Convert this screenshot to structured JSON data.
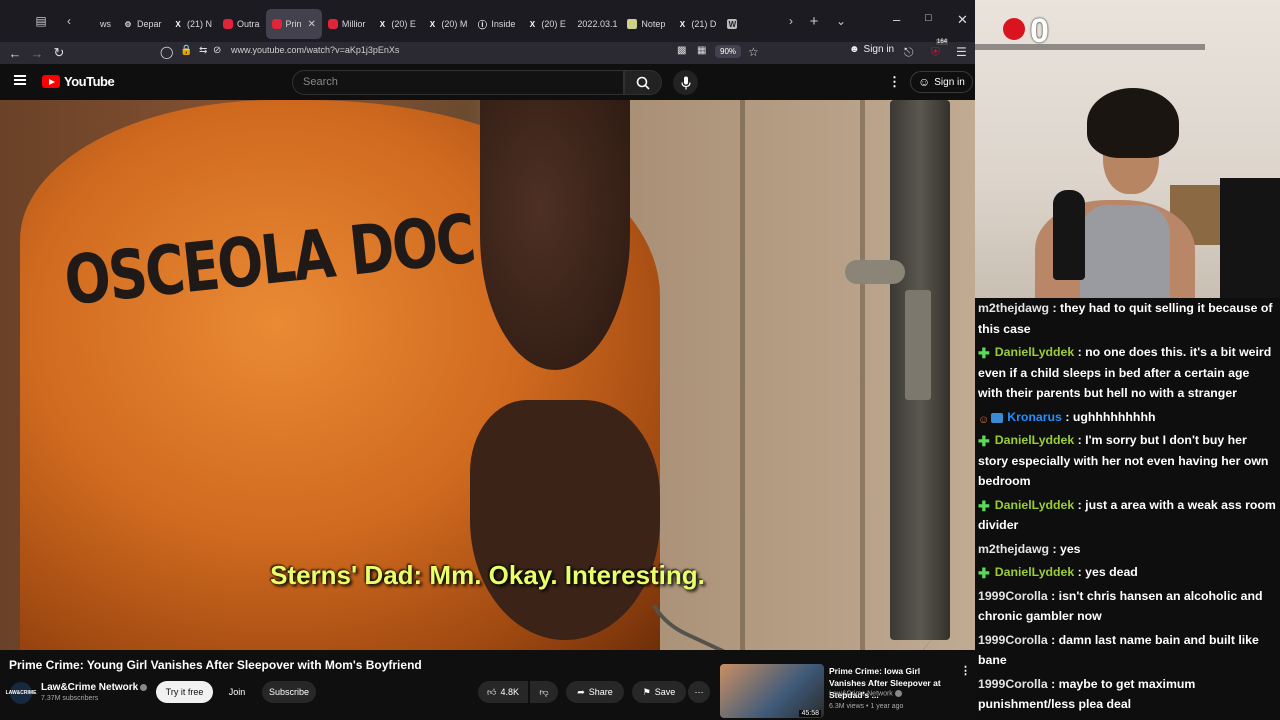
{
  "browser": {
    "tabs": [
      {
        "label": "ws",
        "icon": "nav-left-icon",
        "active": false
      },
      {
        "label": "Depar",
        "icon": "gear-icon",
        "active": false
      },
      {
        "label": "(21) N",
        "icon": "x-logo-icon",
        "active": false
      },
      {
        "label": "Outra",
        "icon": "youtube-icon",
        "active": false
      },
      {
        "label": "Prin",
        "icon": "youtube-icon",
        "active": true
      },
      {
        "label": "Millior",
        "icon": "youtube-icon",
        "active": false
      },
      {
        "label": "(20) E",
        "icon": "x-logo-icon",
        "active": false
      },
      {
        "label": "(20) M",
        "icon": "x-logo-icon",
        "active": false
      },
      {
        "label": "Inside",
        "icon": "insider-icon",
        "active": false
      },
      {
        "label": "(20) E",
        "icon": "x-logo-icon",
        "active": false
      },
      {
        "label": "2022.03.1",
        "icon": "",
        "active": false
      },
      {
        "label": "Notep",
        "icon": "notepad-icon",
        "active": false
      },
      {
        "label": "(21) D",
        "icon": "x-logo-icon",
        "active": false
      },
      {
        "label": "",
        "icon": "wikipedia-icon",
        "active": false
      }
    ],
    "url_host": "www.youtube.com",
    "url_path": "/watch?v=aKp1j3pEnXs",
    "zoom": "90%",
    "sign_in": "Sign in",
    "extension_badge": "164"
  },
  "youtube": {
    "logo_text": "YouTube",
    "search_placeholder": "Search",
    "sign_in": "Sign in",
    "video": {
      "jersey_text": "OSCEOLA DOC",
      "subtitle": "Sterns' Dad: Mm. Okay. Interesting."
    },
    "title": "Prime Crime: Young Girl Vanishes After Sleepover with Mom's Boyfriend",
    "channel": {
      "name": "Law&Crime Network",
      "subscribers": "7.37M subscribers",
      "avatar_text": "LAW&CRIME"
    },
    "buttons": {
      "try_free": "Try it free",
      "join": "Join",
      "subscribe": "Subscribe",
      "likes": "4.8K",
      "share": "Share",
      "save": "Save"
    },
    "recommendation": {
      "title": "Prime Crime: Iowa Girl Vanishes After Sleepover at Stepdad's ...",
      "channel": "Law&Crime Network",
      "meta": "6.3M views • 1 year ago",
      "duration": "45:58"
    }
  },
  "stream": {
    "counter": "0",
    "chat": [
      {
        "user": "m2thejdawg",
        "color": "#e3e3e3",
        "badge": "",
        "text": "they had to quit selling it because of this case"
      },
      {
        "user": "DanielLyddek",
        "color": "#9acd32",
        "badge": "plus",
        "text": "no one does this. it's a bit weird even if a child sleeps in bed after a certain age with their parents but hell no with a stranger"
      },
      {
        "user": "Kronarus",
        "color": "#1e90ff",
        "badge": "sub",
        "text": "ughhhhhhhhh"
      },
      {
        "user": "DanielLyddek",
        "color": "#9acd32",
        "badge": "plus",
        "text": "I'm sorry but I don't buy her story especially with her not even having her own bedroom"
      },
      {
        "user": "DanielLyddek",
        "color": "#9acd32",
        "badge": "plus",
        "text": "just a area with a weak ass room divider"
      },
      {
        "user": "m2thejdawg",
        "color": "#e3e3e3",
        "badge": "",
        "text": "yes"
      },
      {
        "user": "DanielLyddek",
        "color": "#9acd32",
        "badge": "plus",
        "text": "yes dead"
      },
      {
        "user": "1999Corolla",
        "color": "#e3e3e3",
        "badge": "",
        "text": "isn't chris hansen an alcoholic and chronic gambler now"
      },
      {
        "user": "1999Corolla",
        "color": "#e3e3e3",
        "badge": "",
        "text": "damn last name bain and built like bane"
      },
      {
        "user": "1999Corolla",
        "color": "#e3e3e3",
        "badge": "",
        "text": "maybe to get maximum punishment/less plea deal"
      }
    ]
  }
}
